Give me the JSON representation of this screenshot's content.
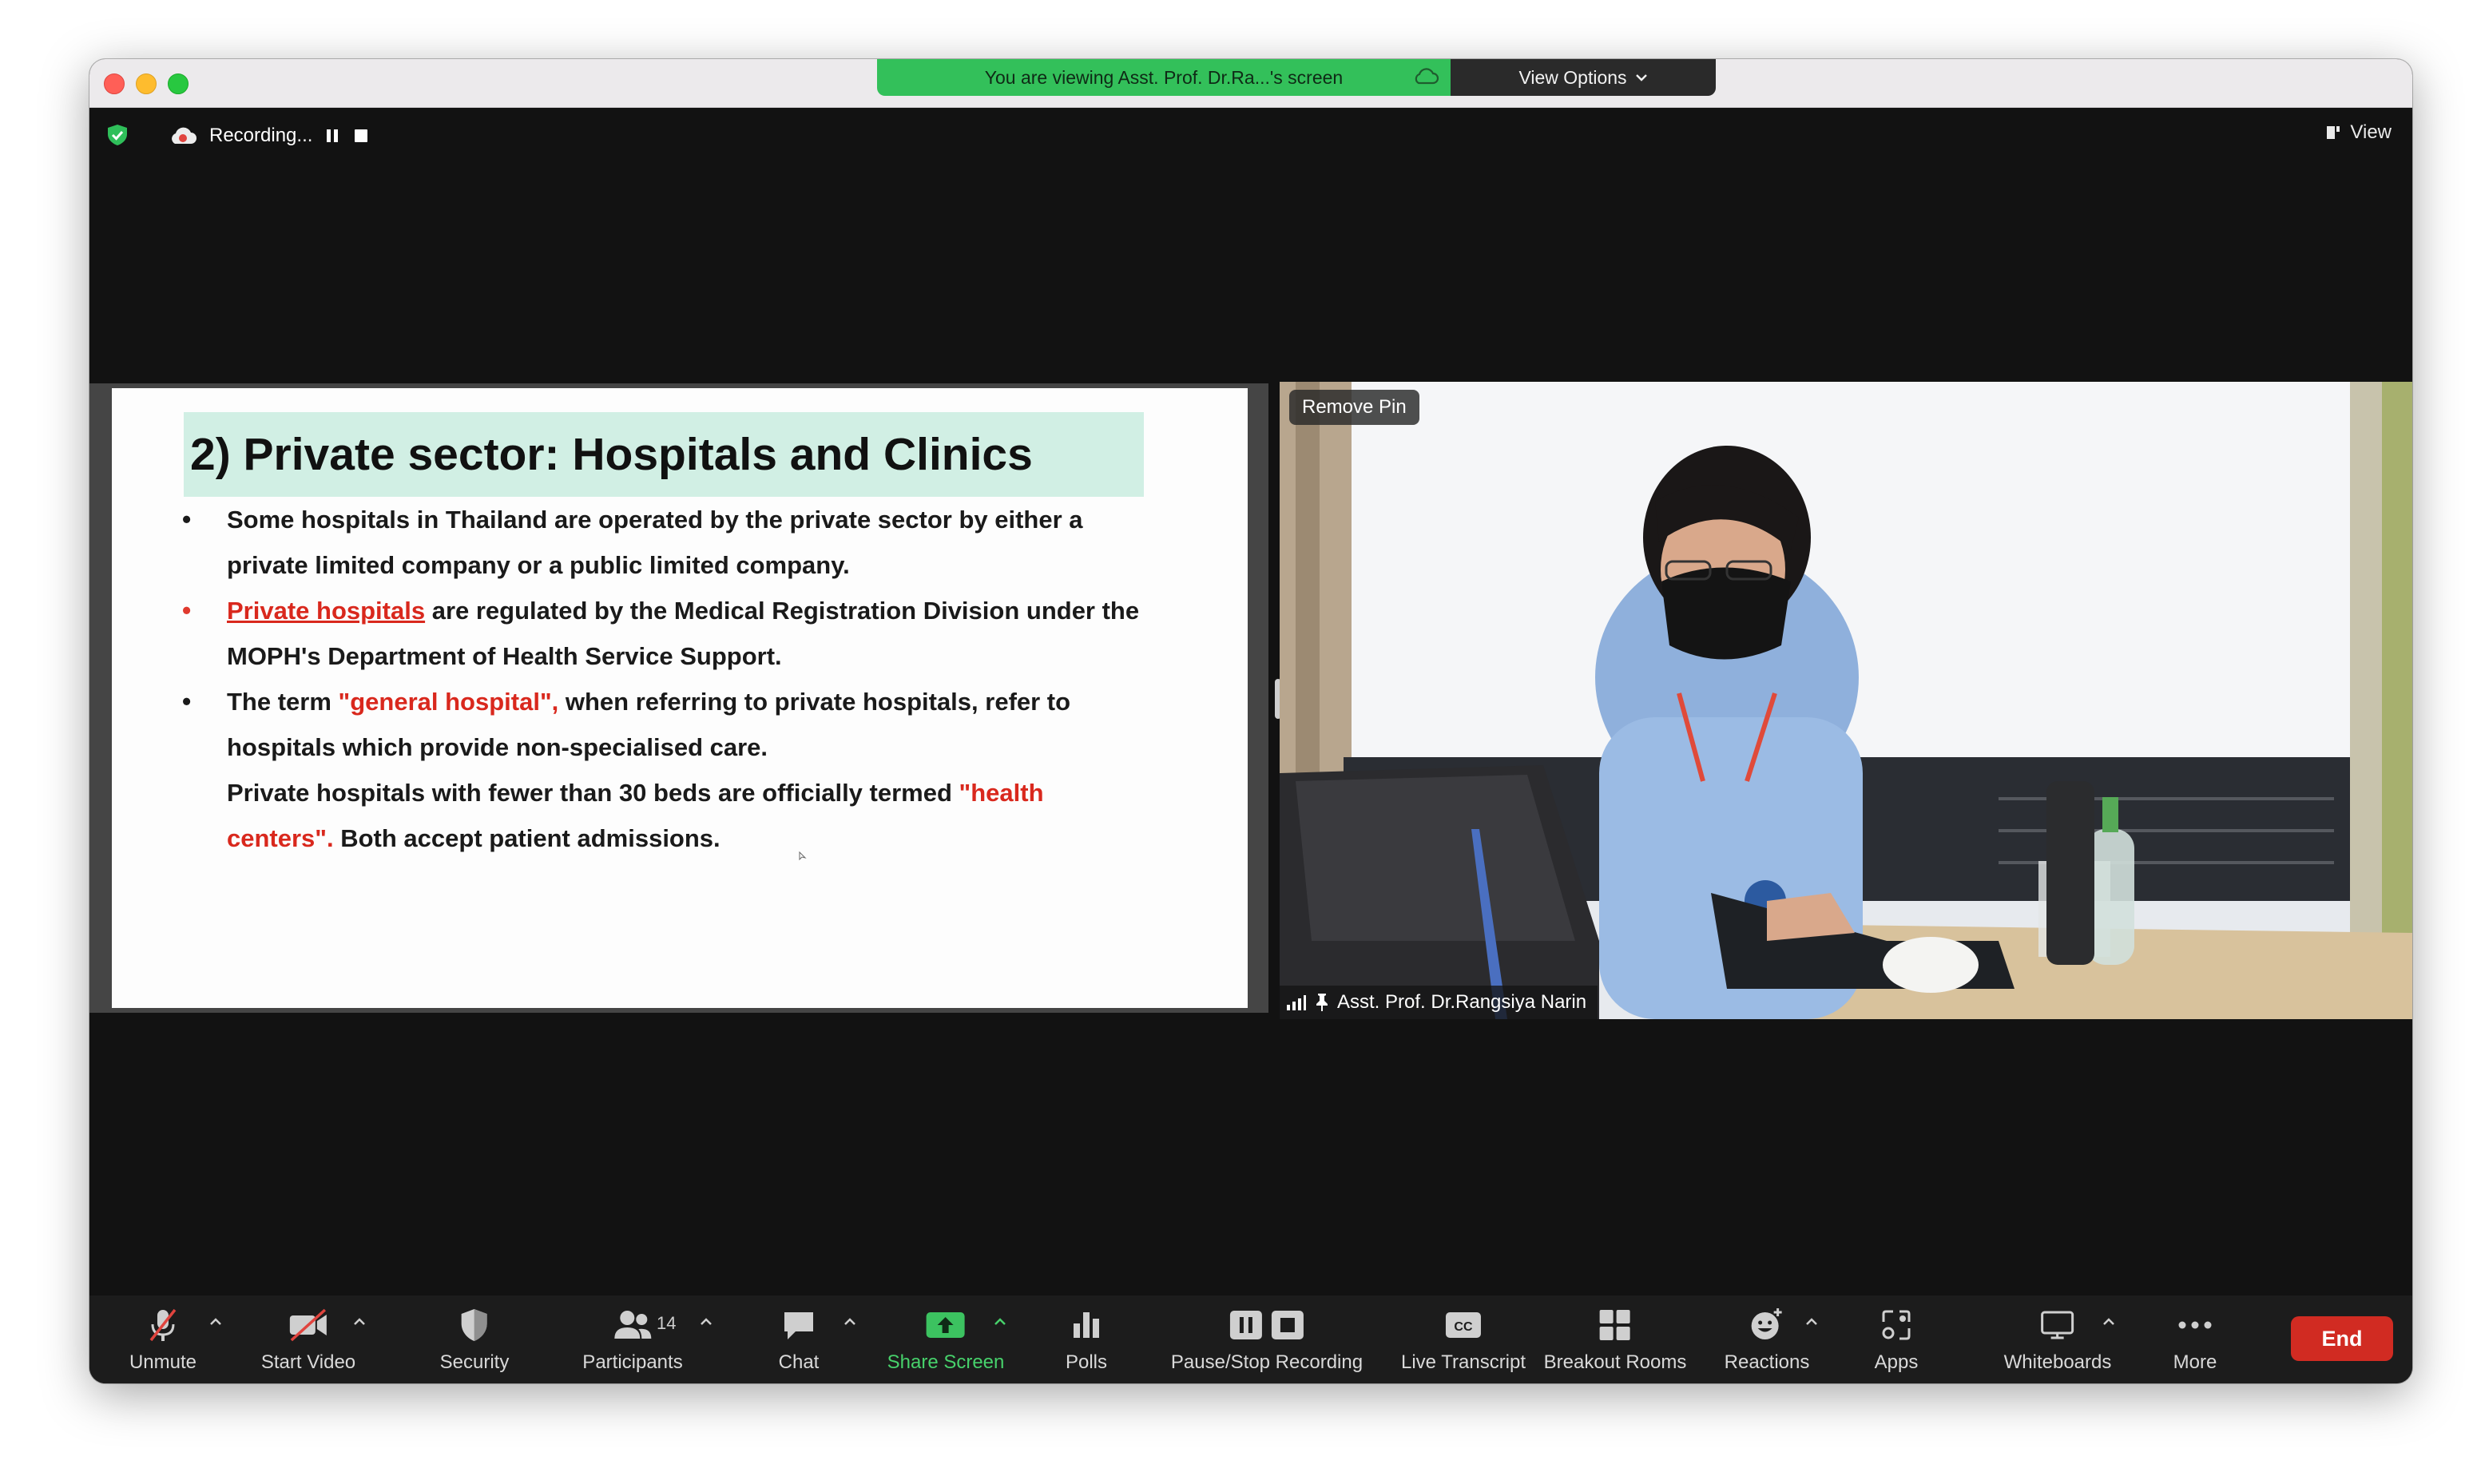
{
  "banner": {
    "viewing_text": "You are viewing Asst. Prof. Dr.Ra...'s screen",
    "view_options_label": "View Options"
  },
  "topbar": {
    "recording_label": "Recording...",
    "view_label": "View"
  },
  "slide": {
    "title": "2) Private sector: Hospitals and Clinics",
    "bullet_1": "Some hospitals in Thailand are operated by the private sector by either a private limited company or a public limited company.",
    "bullet_2_link": "Private hospitals",
    "bullet_2_rest": " are regulated by the Medical Registration Division under the MOPH's Department of Health Service Support.",
    "bullet_3_start": "The term ",
    "bullet_3_highlight": "\"general hospital\",",
    "bullet_3_rest": " when referring to private hospitals, refer to hospitals which provide non-specialised care.",
    "para_start": "Private hospitals with fewer than 30 beds are officially termed ",
    "para_highlight": "\"health centers\".",
    "para_end": " Both accept patient admissions."
  },
  "video": {
    "remove_pin_label": "Remove Pin",
    "participant_name": "Asst. Prof. Dr.Rangsiya Narin"
  },
  "toolbar": {
    "unmute": "Unmute",
    "start_video": "Start Video",
    "security": "Security",
    "participants": "Participants",
    "participants_count": "14",
    "chat": "Chat",
    "share_screen": "Share Screen",
    "polls": "Polls",
    "pause_stop_recording": "Pause/Stop Recording",
    "live_transcript": "Live Transcript",
    "breakout_rooms": "Breakout Rooms",
    "reactions": "Reactions",
    "apps": "Apps",
    "whiteboards": "Whiteboards",
    "more": "More",
    "end": "End"
  },
  "colors": {
    "banner_green": "#33c05a",
    "share_green": "#47d16b",
    "end_red": "#d12b22",
    "slide_title_bg": "#d1efe4",
    "slide_red": "#d9281d"
  }
}
